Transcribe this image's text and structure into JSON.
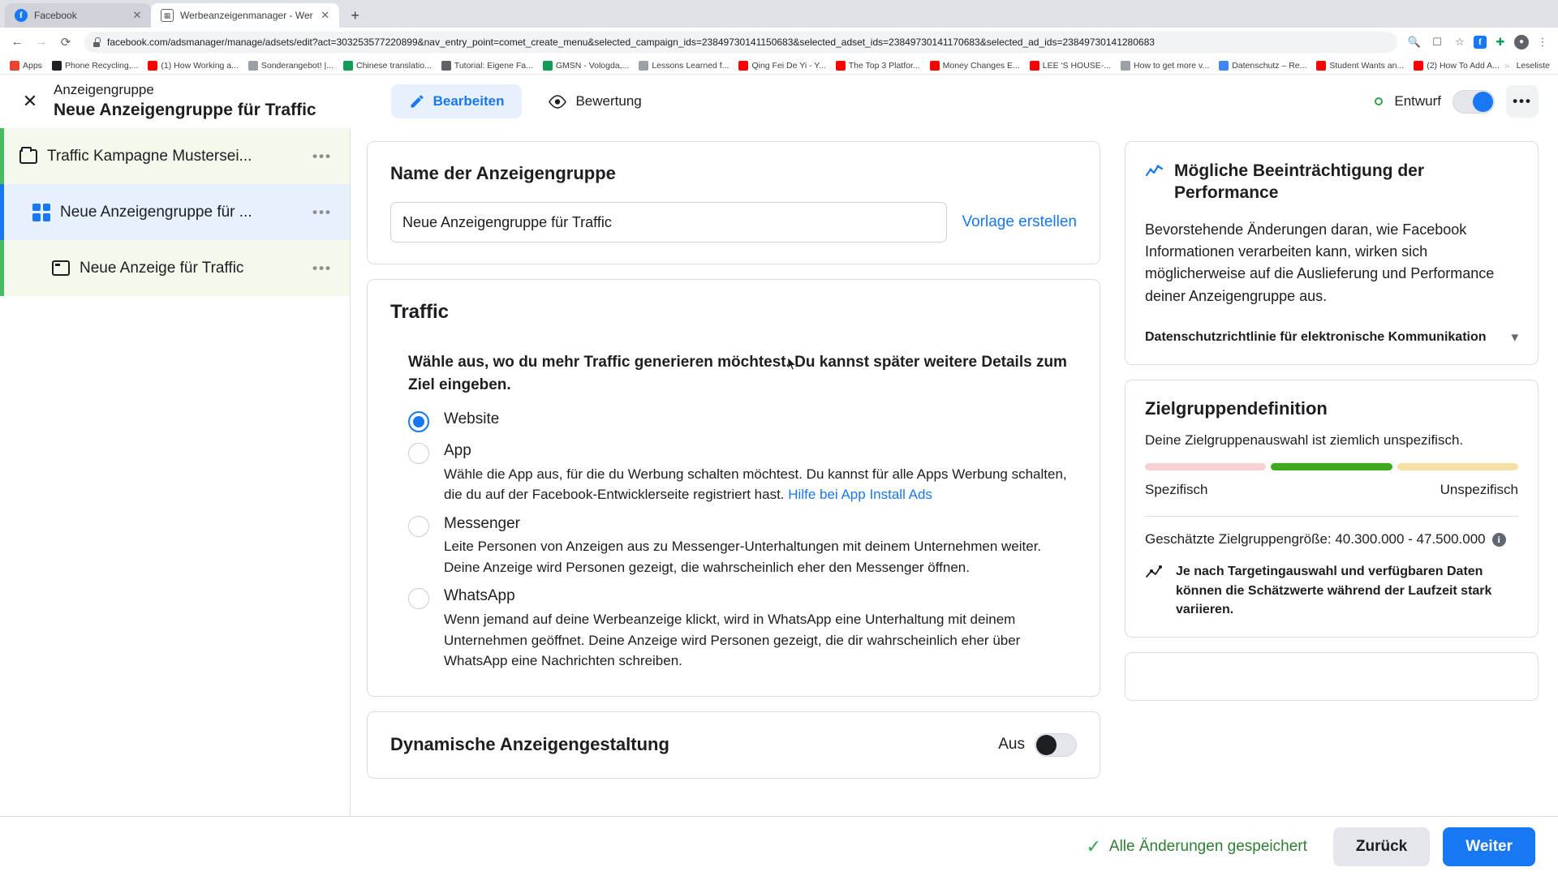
{
  "browser": {
    "tabs": [
      {
        "title": "Facebook",
        "icon": "facebook-icon",
        "active": false
      },
      {
        "title": "Werbeanzeigenmanager - Wer",
        "icon": "ads-manager-icon",
        "active": true
      }
    ],
    "new_tab_label": "+",
    "nav": {
      "back": "←",
      "forward": "→",
      "reload": "⟳"
    },
    "url": "facebook.com/adsmanager/manage/adsets/edit?act=303253577220899&nav_entry_point=comet_create_menu&selected_campaign_ids=23849730141150683&selected_adset_ids=23849730141170683&selected_ad_ids=23849730141280683",
    "bookmarks": [
      {
        "label": "Apps",
        "color": "#ea4335"
      },
      {
        "label": "Phone Recycling,...",
        "color": "#202124"
      },
      {
        "label": "(1) How Working a...",
        "color": "#ff0000"
      },
      {
        "label": "Sonderangebot! |...",
        "color": "#9aa0a6"
      },
      {
        "label": "Chinese translatio...",
        "color": "#0f9d58"
      },
      {
        "label": "Tutorial: Eigene Fa...",
        "color": "#5f6368"
      },
      {
        "label": "GMSN - Vologda,...",
        "color": "#0f9d58"
      },
      {
        "label": "Lessons Learned f...",
        "color": "#9aa0a6"
      },
      {
        "label": "Qing Fei De Yi - Y...",
        "color": "#ff0000"
      },
      {
        "label": "The Top 3 Platfor...",
        "color": "#ff0000"
      },
      {
        "label": "Money Changes E...",
        "color": "#ff0000"
      },
      {
        "label": "LEE 'S HOUSE-...",
        "color": "#ff0000"
      },
      {
        "label": "How to get more v...",
        "color": "#9aa0a6"
      },
      {
        "label": "Datenschutz – Re...",
        "color": "#4285f4"
      },
      {
        "label": "Student Wants an...",
        "color": "#ff0000"
      },
      {
        "label": "(2) How To Add A...",
        "color": "#ff0000"
      }
    ],
    "reading_list_label": "Leseliste"
  },
  "header": {
    "close_icon": "close-icon",
    "kicker": "Anzeigengruppe",
    "title": "Neue Anzeigengruppe für Traffic",
    "tabs": [
      {
        "label": "Bearbeiten",
        "icon": "pencil-icon",
        "active": true
      },
      {
        "label": "Bewertung",
        "icon": "eye-icon",
        "active": false
      }
    ],
    "status_label": "Entwurf",
    "status_color": "#31a24c",
    "toggle_on": true,
    "more_label": "•••"
  },
  "sidebar": {
    "items": [
      {
        "label": "Traffic Kampagne Mustersei...",
        "icon": "folder-icon",
        "level": "campaign",
        "menu": "•••"
      },
      {
        "label": "Neue Anzeigengruppe für ...",
        "icon": "grid-icon",
        "level": "adset",
        "menu": "•••"
      },
      {
        "label": "Neue Anzeige für Traffic",
        "icon": "window-icon",
        "level": "ad",
        "menu": "•••"
      }
    ]
  },
  "main": {
    "name_card": {
      "title": "Name der Anzeigengruppe",
      "input_value": "Neue Anzeigengruppe für Traffic",
      "input_placeholder": "Name der Anzeigengruppe",
      "template_link": "Vorlage erstellen"
    },
    "traffic_card": {
      "title": "Traffic",
      "question": "Wähle aus, wo du mehr Traffic generieren möchtest. Du kannst später weitere Details zum Ziel eingeben.",
      "options": [
        {
          "label": "Website",
          "desc": "",
          "selected": true,
          "link": ""
        },
        {
          "label": "App",
          "desc": "Wähle die App aus, für die du Werbung schalten möchtest. Du kannst für alle Apps Werbung schalten, die du auf der Facebook-Entwicklerseite registriert hast. ",
          "selected": false,
          "link": "Hilfe bei App Install Ads"
        },
        {
          "label": "Messenger",
          "desc": "Leite Personen von Anzeigen aus zu Messenger-Unterhaltungen mit deinem Unternehmen weiter. Deine Anzeige wird Personen gezeigt, die wahrscheinlich eher den Messenger öffnen.",
          "selected": false,
          "link": ""
        },
        {
          "label": "WhatsApp",
          "desc": "Wenn jemand auf deine Werbeanzeige klickt, wird in WhatsApp eine Unterhaltung mit deinem Unternehmen geöffnet. Deine Anzeige wird Personen gezeigt, die dir wahrscheinlich eher über WhatsApp eine Nachrichten schreiben.",
          "selected": false,
          "link": ""
        }
      ]
    },
    "dynamic_card": {
      "title": "Dynamische Anzeigengestaltung",
      "state_label": "Aus",
      "toggle_on": false
    }
  },
  "right_panel": {
    "performance_card": {
      "icon": "trend-chart-icon",
      "title": "Mögliche Beeinträchtigung der Performance",
      "body": "Bevorstehende Änderungen daran, wie Facebook Informationen verarbeiten kann, wirken sich möglicherweise auf die Auslieferung und Performance deiner Anzeigengruppe aus.",
      "footer_link": "Datenschutzrichtlinie für elektronische Kommunikation",
      "chevron": "chevron-down-icon"
    },
    "audience_card": {
      "title": "Zielgruppendefinition",
      "subtitle": "Deine Zielgruppenauswahl ist ziemlich unspezifisch.",
      "meter_segments": [
        {
          "color": "#f9d3d3",
          "active": false
        },
        {
          "color": "#3caa1f",
          "active": true
        },
        {
          "color": "#f7e0a3",
          "active": false
        }
      ],
      "scale_left": "Spezifisch",
      "scale_right": "Unspezifisch",
      "estimate_label": "Geschätzte Zielgruppengröße: 40.300.000 - 47.500.000",
      "info_icon": "info-icon",
      "note": "Je nach Targetingauswahl und verfügbaren Daten können die Schätzwerte während der Laufzeit stark variieren."
    }
  },
  "footer": {
    "saved_text": "Alle Änderungen gespeichert",
    "saved_icon": "check-icon",
    "back_button": "Zurück",
    "next_button": "Weiter"
  }
}
